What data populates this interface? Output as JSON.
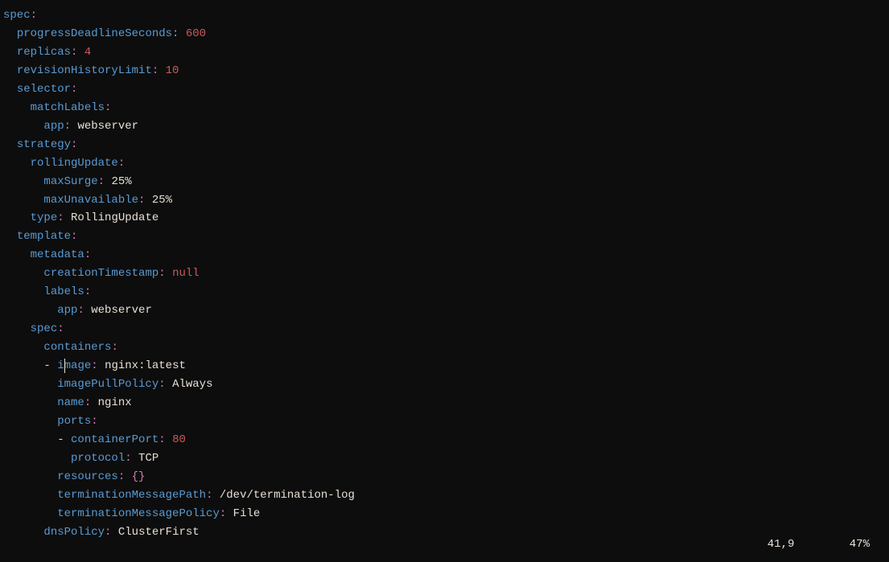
{
  "lines": [
    {
      "indent": 0,
      "key": "spec",
      "colon": true
    },
    {
      "indent": 1,
      "key": "progressDeadlineSeconds",
      "colon": true,
      "value": "600",
      "valueType": "number"
    },
    {
      "indent": 1,
      "key": "replicas",
      "colon": true,
      "value": "4",
      "valueType": "number"
    },
    {
      "indent": 1,
      "key": "revisionHistoryLimit",
      "colon": true,
      "value": "10",
      "valueType": "number"
    },
    {
      "indent": 1,
      "key": "selector",
      "colon": true
    },
    {
      "indent": 2,
      "key": "matchLabels",
      "colon": true
    },
    {
      "indent": 3,
      "key": "app",
      "colon": true,
      "value": "webserver",
      "valueType": "string"
    },
    {
      "indent": 1,
      "key": "strategy",
      "colon": true
    },
    {
      "indent": 2,
      "key": "rollingUpdate",
      "colon": true
    },
    {
      "indent": 3,
      "key": "maxSurge",
      "colon": true,
      "value": "25%",
      "valueType": "string"
    },
    {
      "indent": 3,
      "key": "maxUnavailable",
      "colon": true,
      "value": "25%",
      "valueType": "string"
    },
    {
      "indent": 2,
      "key": "type",
      "colon": true,
      "value": "RollingUpdate",
      "valueType": "string"
    },
    {
      "indent": 1,
      "key": "template",
      "colon": true
    },
    {
      "indent": 2,
      "key": "metadata",
      "colon": true
    },
    {
      "indent": 3,
      "key": "creationTimestamp",
      "colon": true,
      "value": "null",
      "valueType": "null"
    },
    {
      "indent": 3,
      "key": "labels",
      "colon": true
    },
    {
      "indent": 4,
      "key": "app",
      "colon": true,
      "value": "webserver",
      "valueType": "string"
    },
    {
      "indent": 2,
      "key": "spec",
      "colon": true
    },
    {
      "indent": 3,
      "key": "containers",
      "colon": true
    },
    {
      "indent": 3,
      "dash": true,
      "key": "image",
      "colon": true,
      "value": "nginx:latest",
      "valueType": "string",
      "cursor": true,
      "cursorCol": 8
    },
    {
      "indent": 4,
      "key": "imagePullPolicy",
      "colon": true,
      "value": "Always",
      "valueType": "string"
    },
    {
      "indent": 4,
      "key": "name",
      "colon": true,
      "value": "nginx",
      "valueType": "string"
    },
    {
      "indent": 4,
      "key": "ports",
      "colon": true
    },
    {
      "indent": 4,
      "dash": true,
      "key": "containerPort",
      "colon": true,
      "value": "80",
      "valueType": "number"
    },
    {
      "indent": 5,
      "key": "protocol",
      "colon": true,
      "value": "TCP",
      "valueType": "string"
    },
    {
      "indent": 4,
      "key": "resources",
      "colon": true,
      "value": "{}",
      "valueType": "brace"
    },
    {
      "indent": 4,
      "key": "terminationMessagePath",
      "colon": true,
      "value": "/dev/termination-log",
      "valueType": "string"
    },
    {
      "indent": 4,
      "key": "terminationMessagePolicy",
      "colon": true,
      "value": "File",
      "valueType": "string"
    },
    {
      "indent": 3,
      "key": "dnsPolicy",
      "colon": true,
      "value": "ClusterFirst",
      "valueType": "string"
    }
  ],
  "status": {
    "position": "41,9",
    "percent": "47%"
  }
}
